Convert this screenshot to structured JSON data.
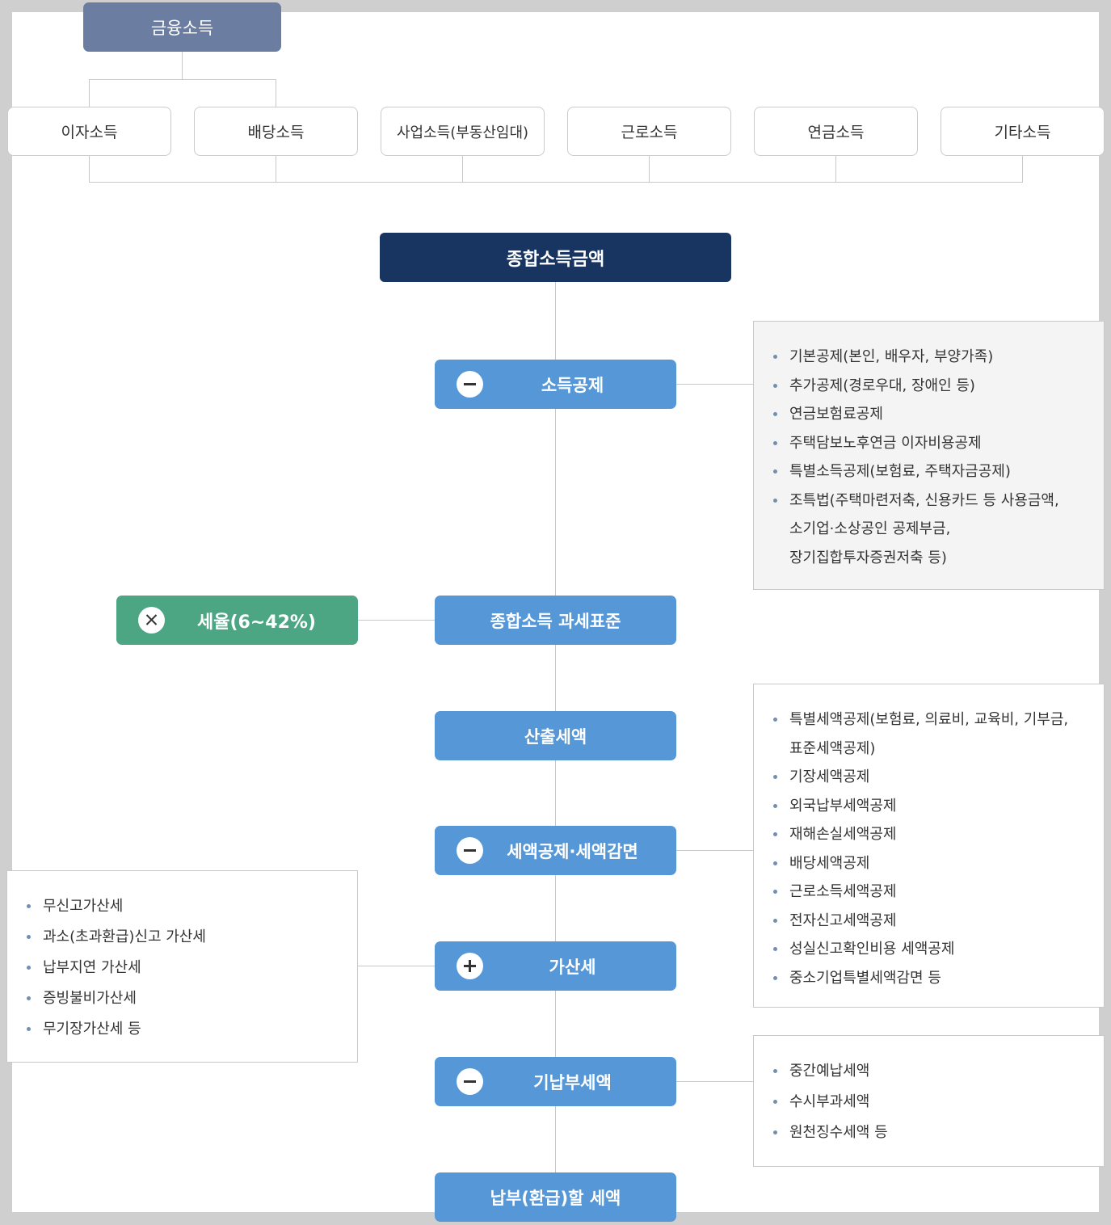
{
  "top_node": "금융소득",
  "sources": [
    "이자소득",
    "배당소득",
    "사업소득(부동산임대)",
    "근로소득",
    "연금소득",
    "기타소득"
  ],
  "main_node": "종합소득금액",
  "steps": {
    "income_deduction": {
      "label": "소득공제",
      "operator": "minus"
    },
    "tax_base": {
      "label": "종합소득 과세표준"
    },
    "calculated_tax": {
      "label": "산출세액"
    },
    "tax_credit": {
      "label": "세액공제·세액감면",
      "operator": "minus"
    },
    "additional_tax": {
      "label": "가산세",
      "operator": "plus"
    },
    "prepaid_tax": {
      "label": "기납부세액",
      "operator": "minus"
    },
    "final_tax": {
      "label": "납부(환급)할 세액"
    }
  },
  "rate_node": {
    "label": "세율(6~42%)",
    "operator": "times"
  },
  "notes": {
    "income_deduction": {
      "items": [
        "기본공제(본인, 배우자, 부양가족)",
        "추가공제(경로우대, 장애인 등)",
        "연금보험료공제",
        "주택담보노후연금 이자비용공제",
        "특별소득공제(보험료, 주택자금공제)",
        "조특법(주택마련저축, 신용카드 등 사용금액,"
      ],
      "continuation": [
        "소기업·소상공인 공제부금,",
        "장기집합투자증권저축 등)"
      ]
    },
    "tax_credit": {
      "items": [
        "특별세액공제(보험료, 의료비, 교육비, 기부금,",
        "기장세액공제",
        "외국납부세액공제",
        "재해손실세액공제",
        "배당세액공제",
        "근로소득세액공제",
        "전자신고세액공제",
        "성실신고확인비용 세액공제",
        "중소기업특별세액감면 등"
      ],
      "continuation_after_first": "표준세액공제)"
    },
    "additional_tax": {
      "items": [
        "무신고가산세",
        "과소(초과환급)신고 가산세",
        "납부지연 가산세",
        "증빙불비가산세",
        "무기장가산세 등"
      ]
    },
    "prepaid_tax": {
      "items": [
        "중간예납세액",
        "수시부과세액",
        "원천징수세액 등"
      ]
    }
  },
  "colors": {
    "top_node": "#6b7da0",
    "main_node": "#173560",
    "step": "#5597d7",
    "rate": "#4ca684",
    "connector": "#c8c8c8",
    "bullet": "#6f8fb6"
  }
}
